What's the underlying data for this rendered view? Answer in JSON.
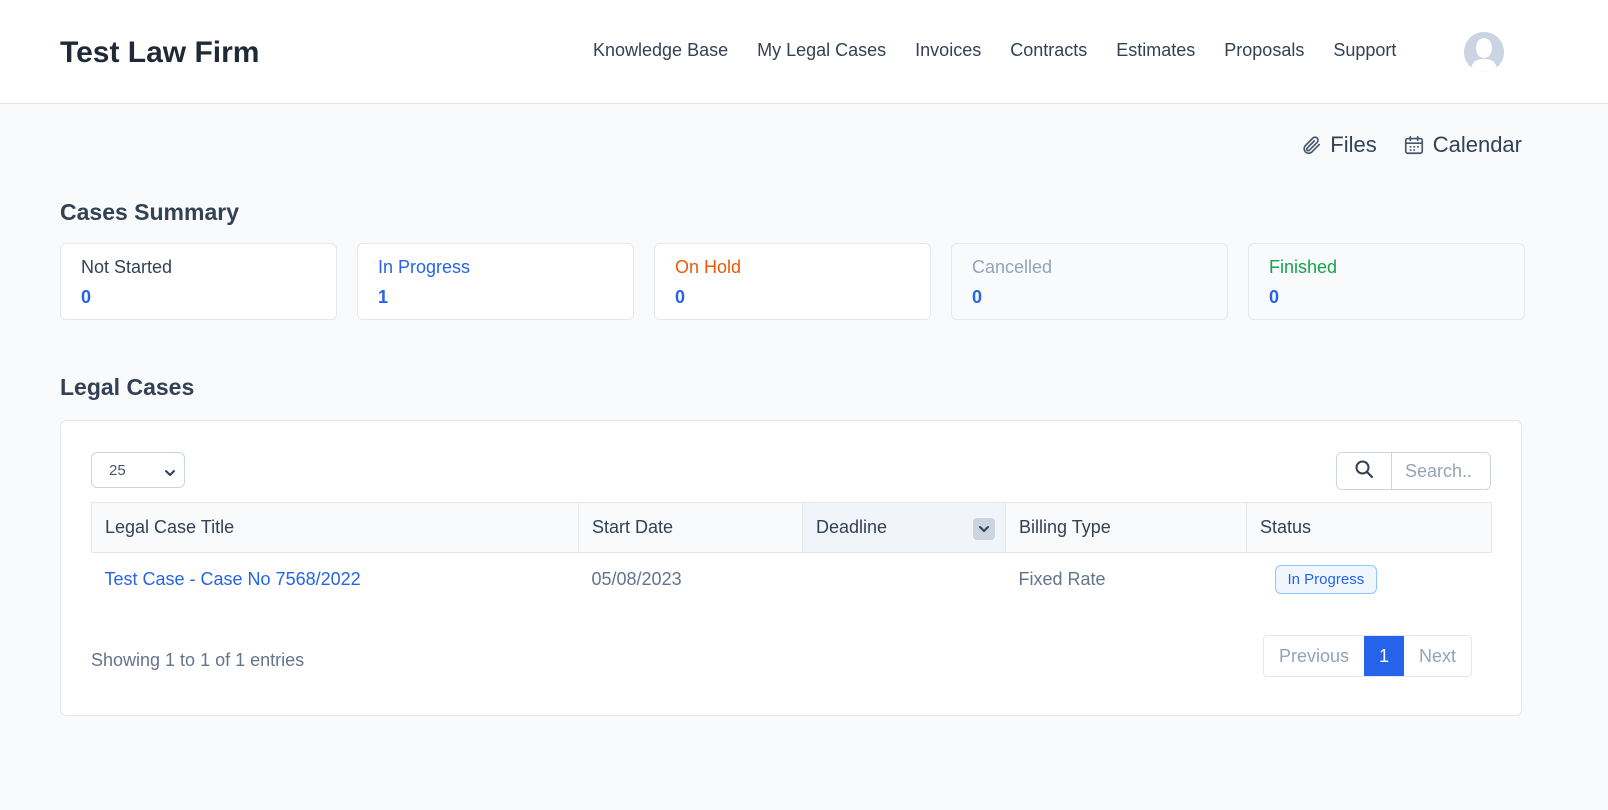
{
  "header": {
    "brand": "Test Law Firm",
    "nav": [
      "Knowledge Base",
      "My Legal Cases",
      "Invoices",
      "Contracts",
      "Estimates",
      "Proposals",
      "Support"
    ],
    "avatar_icon": "user-avatar-icon"
  },
  "quick_links": {
    "files": "Files",
    "calendar": "Calendar"
  },
  "summary": {
    "title": "Cases Summary",
    "cards": [
      {
        "label": "Not Started",
        "count": "0",
        "color": "#334155"
      },
      {
        "label": "In Progress",
        "count": "1",
        "color": "#2563eb"
      },
      {
        "label": "On Hold",
        "count": "0",
        "color": "#ea580c"
      },
      {
        "label": "Cancelled",
        "count": "0",
        "color": "#94a3b8"
      },
      {
        "label": "Finished",
        "count": "0",
        "color": "#16a34a"
      }
    ]
  },
  "cases": {
    "title": "Legal Cases",
    "page_length": "25",
    "search_placeholder": "Search..",
    "columns": [
      "Legal Case Title",
      "Start Date",
      "Deadline",
      "Billing Type",
      "Status"
    ],
    "rows": [
      {
        "title": "Test Case - Case No 7568/2022",
        "start_date": "05/08/2023",
        "deadline": "",
        "billing_type": "Fixed Rate",
        "status": "In Progress"
      }
    ],
    "info": "Showing 1 to 1 of 1 entries",
    "pager": {
      "previous": "Previous",
      "current": "1",
      "next": "Next"
    }
  },
  "colors": {
    "accent": "#2563eb"
  }
}
